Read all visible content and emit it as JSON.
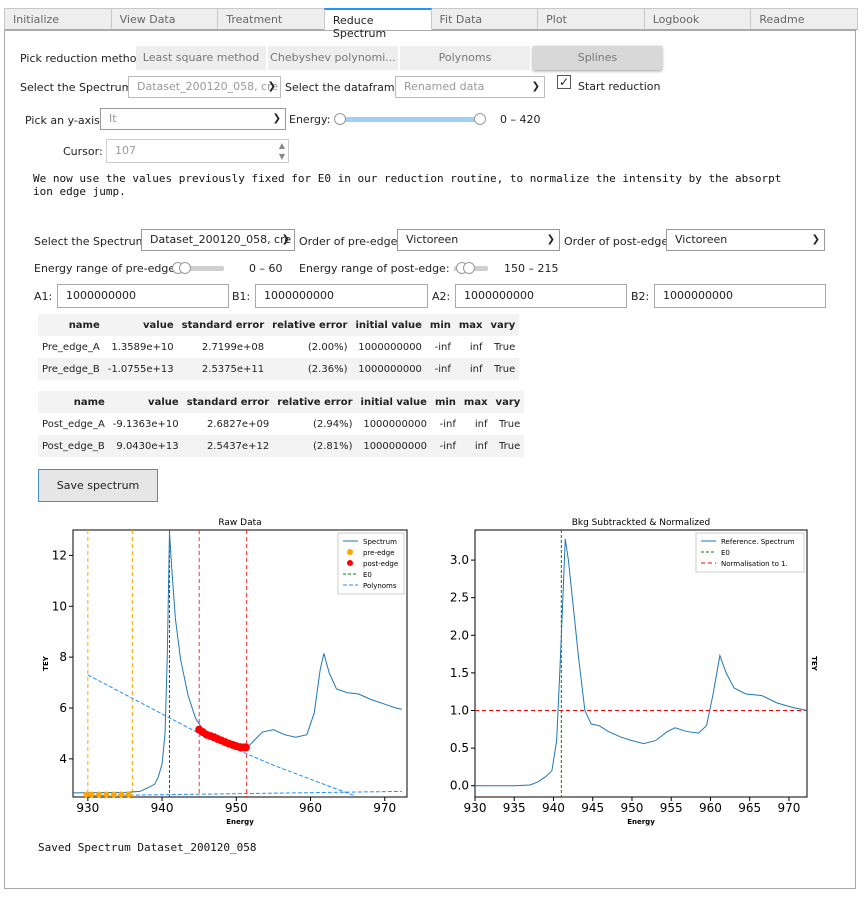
{
  "tabs": [
    "Initialize",
    "View Data",
    "Treatment",
    "Reduce Spectrum",
    "Fit Data",
    "Plot",
    "Logbook",
    "Readme"
  ],
  "active_tab": 3,
  "reduction": {
    "pick_label": "Pick reduction method:",
    "methods": [
      "Least square method",
      "Chebyshev polynomi...",
      "Polynoms",
      "Splines"
    ],
    "selected_method": 3
  },
  "row2": {
    "spectrum_label": "Select the Spectrum:",
    "spectrum_value": "Dataset_200120_058, cre",
    "dataframe_label": "Select the dataframe:",
    "dataframe_value": "Renamed data",
    "start_label": "Start reduction",
    "start_checked": "✓"
  },
  "row3": {
    "yaxis_label": "Pick an y-axis",
    "yaxis_value": "It",
    "energy_label": "Energy:",
    "energy_range": "0 – 420",
    "energy_min_frac": 0,
    "energy_max_frac": 1
  },
  "cursor": {
    "label": "Cursor:",
    "value": "107"
  },
  "description": "We now use the values previously fixed for E0 in our reduction routine, to normalize the intensity by the absorpt\nion edge jump.",
  "params": {
    "spectrum_label": "Select the Spectrum:",
    "spectrum_value": "Dataset_200120_058, cre",
    "pre_order_label": "Order of pre-edge:",
    "pre_order_value": "Victoreen",
    "post_order_label": "Order of post-edge:",
    "post_order_value": "Victoreen",
    "pre_range_label": "Energy range of pre-edge:",
    "pre_range_value": "0 – 60",
    "post_range_label": "Energy range of post-edge:",
    "post_range_value": "150 – 215",
    "a1_label": "A1:",
    "a1_value": "1000000000",
    "b1_label": "B1:",
    "b1_value": "1000000000",
    "a2_label": "A2:",
    "a2_value": "1000000000",
    "b2_label": "B2:",
    "b2_value": "1000000000"
  },
  "table_headers": [
    "name",
    "value",
    "standard error",
    "relative error",
    "initial value",
    "min",
    "max",
    "vary"
  ],
  "pre_table": [
    [
      "Pre_edge_A",
      "1.3589e+10",
      "2.7199e+08",
      "(2.00%)",
      "1000000000",
      "-inf",
      "inf",
      "True"
    ],
    [
      "Pre_edge_B",
      "-1.0755e+13",
      "2.5375e+11",
      "(2.36%)",
      "1000000000",
      "-inf",
      "inf",
      "True"
    ]
  ],
  "post_table": [
    [
      "Post_edge_A",
      "-9.1363e+10",
      "2.6827e+09",
      "(2.94%)",
      "1000000000",
      "-inf",
      "inf",
      "True"
    ],
    [
      "Post_edge_B",
      "9.0430e+13",
      "2.5437e+12",
      "(2.81%)",
      "1000000000",
      "-inf",
      "inf",
      "True"
    ]
  ],
  "save_button": "Save spectrum",
  "saved_message": "Saved Spectrum Dataset_200120_058",
  "chart_data": [
    {
      "type": "line",
      "title": "Raw Data",
      "xlabel": "Energy",
      "ylabel": "TEY",
      "xlim": [
        928,
        973
      ],
      "ylim": [
        2.5,
        13.0
      ],
      "xticks": [
        930,
        940,
        950,
        960,
        970
      ],
      "yticks": [
        4,
        6,
        8,
        10,
        12
      ],
      "legend": [
        "Spectrum",
        "pre-edge",
        "post-edge",
        "E0",
        "Polynoms"
      ],
      "legend_position": "top-right",
      "colors": {
        "spectrum": "#1f77b4",
        "pre_edge": "#ffa500",
        "post_edge": "#ff0000",
        "e0": "#008000",
        "polynoms": "#1e90ff"
      },
      "spectrum": [
        [
          928.1,
          2.66
        ],
        [
          935,
          2.68
        ],
        [
          937,
          2.72
        ],
        [
          938,
          2.85
        ],
        [
          939,
          3.0
        ],
        [
          939.5,
          3.3
        ],
        [
          940,
          3.8
        ],
        [
          940.4,
          5.0
        ],
        [
          940.7,
          8.0
        ],
        [
          941.0,
          12.9
        ],
        [
          941.3,
          11.5
        ],
        [
          941.8,
          9.5
        ],
        [
          942.5,
          7.9
        ],
        [
          943.5,
          6.5
        ],
        [
          944.5,
          5.6
        ],
        [
          945.5,
          5.15
        ],
        [
          947,
          4.85
        ],
        [
          949,
          4.6
        ],
        [
          950.5,
          4.45
        ],
        [
          951.5,
          4.45
        ],
        [
          952.5,
          4.75
        ],
        [
          953.5,
          5.05
        ],
        [
          955,
          5.15
        ],
        [
          956.5,
          4.95
        ],
        [
          958,
          4.85
        ],
        [
          959.5,
          4.95
        ],
        [
          960.5,
          5.8
        ],
        [
          961.3,
          7.5
        ],
        [
          961.8,
          8.15
        ],
        [
          962.5,
          7.4
        ],
        [
          963.5,
          6.75
        ],
        [
          965,
          6.6
        ],
        [
          966.5,
          6.55
        ],
        [
          968,
          6.35
        ],
        [
          970,
          6.15
        ],
        [
          971.5,
          6.0
        ],
        [
          972.3,
          5.95
        ]
      ],
      "pre_edge_points": [
        [
          929.8,
          2.6
        ],
        [
          930.5,
          2.6
        ],
        [
          931.5,
          2.6
        ],
        [
          932.5,
          2.6
        ],
        [
          933.5,
          2.6
        ],
        [
          934.5,
          2.6
        ],
        [
          935.5,
          2.6
        ]
      ],
      "post_edge_points": [
        [
          945,
          5.15
        ],
        [
          945.5,
          5.05
        ],
        [
          946,
          4.95
        ],
        [
          946.5,
          4.9
        ],
        [
          947,
          4.85
        ],
        [
          947.5,
          4.78
        ],
        [
          948,
          4.72
        ],
        [
          948.5,
          4.66
        ],
        [
          949,
          4.6
        ],
        [
          949.5,
          4.55
        ],
        [
          950,
          4.5
        ],
        [
          950.5,
          4.46
        ],
        [
          951,
          4.45
        ],
        [
          951.3,
          4.45
        ]
      ],
      "e0": 941.0,
      "vlines_orange": [
        930.0,
        936.0
      ],
      "vlines_red": [
        945.0,
        951.4
      ],
      "polynom_descending": [
        [
          930,
          7.3
        ],
        [
          945,
          5.0
        ],
        [
          955,
          3.75
        ],
        [
          960,
          3.2
        ],
        [
          965,
          2.65
        ],
        [
          966,
          2.55
        ]
      ],
      "polynom_flat": [
        [
          930,
          2.55
        ],
        [
          972.3,
          2.72
        ]
      ]
    },
    {
      "type": "line",
      "title": "Bkg Subtrackted & Normalized",
      "xlabel": "Energy",
      "ylabel": "TEY",
      "xlim": [
        930,
        972.3
      ],
      "ylim": [
        -0.15,
        3.4
      ],
      "xticks": [
        930,
        935,
        940,
        945,
        950,
        955,
        960,
        965,
        970
      ],
      "yticks": [
        0.0,
        0.5,
        1.0,
        1.5,
        2.0,
        2.5,
        3.0
      ],
      "legend": [
        "Reference. Spectrum",
        "E0",
        "Normalisation to 1."
      ],
      "legend_position": "top-right",
      "colors": {
        "spectrum": "#1f77b4",
        "e0": "#008000",
        "normalisation": "#ff0000"
      },
      "spectrum": [
        [
          930,
          0.0
        ],
        [
          935,
          0.0
        ],
        [
          937,
          0.01
        ],
        [
          938,
          0.05
        ],
        [
          939,
          0.12
        ],
        [
          939.8,
          0.2
        ],
        [
          940.4,
          0.6
        ],
        [
          940.8,
          1.5
        ],
        [
          941.2,
          2.5
        ],
        [
          941.5,
          3.28
        ],
        [
          941.9,
          3.0
        ],
        [
          942.5,
          2.4
        ],
        [
          943.2,
          1.7
        ],
        [
          944,
          1.0
        ],
        [
          944.8,
          0.82
        ],
        [
          945.8,
          0.8
        ],
        [
          947,
          0.72
        ],
        [
          948.5,
          0.65
        ],
        [
          950,
          0.6
        ],
        [
          951.5,
          0.56
        ],
        [
          953,
          0.6
        ],
        [
          954.5,
          0.72
        ],
        [
          955.5,
          0.77
        ],
        [
          957,
          0.72
        ],
        [
          958.5,
          0.7
        ],
        [
          959.5,
          0.8
        ],
        [
          960.3,
          1.2
        ],
        [
          961.2,
          1.73
        ],
        [
          962,
          1.5
        ],
        [
          963,
          1.3
        ],
        [
          964.5,
          1.22
        ],
        [
          966.5,
          1.2
        ],
        [
          968.5,
          1.1
        ],
        [
          970.5,
          1.04
        ],
        [
          972.3,
          1.0
        ]
      ],
      "e0": 941.0,
      "normalisation": 1.0
    }
  ]
}
